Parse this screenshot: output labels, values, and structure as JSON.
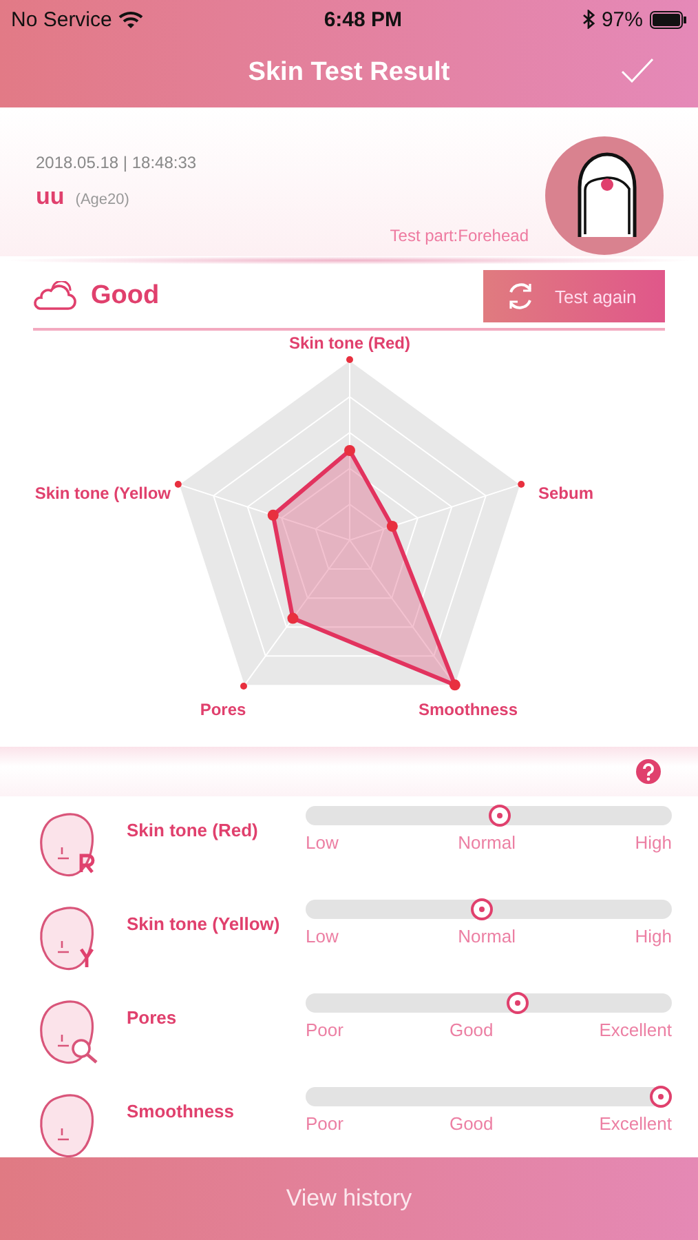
{
  "status_bar": {
    "carrier": "No Service",
    "time": "6:48 PM",
    "battery": "97%"
  },
  "nav": {
    "title": "Skin Test Result"
  },
  "record": {
    "datetime": "2018.05.18 | 18:48:33",
    "name": "uu",
    "age": "(Age20)",
    "test_part": "Test part:Forehead"
  },
  "result": {
    "rating": "Good",
    "button": "Test again"
  },
  "radar": {
    "axes": [
      {
        "label": "Skin tone (Red)"
      },
      {
        "label": "Sebum"
      },
      {
        "label": "Smoothness"
      },
      {
        "label": "Pores"
      },
      {
        "label": "Skin tone (Yellow"
      }
    ]
  },
  "metrics": [
    {
      "kind": "red",
      "label": "Skin tone (Red)",
      "level": 0.53,
      "scale": [
        "Low",
        "Normal",
        "High"
      ]
    },
    {
      "kind": "yellow",
      "label": "Skin tone (Yellow)",
      "level": 0.48,
      "scale": [
        "Low",
        "Normal",
        "High"
      ]
    },
    {
      "kind": "pores",
      "label": "Pores",
      "level": 0.58,
      "scale": [
        "Poor",
        "Good",
        "Excellent"
      ]
    },
    {
      "kind": "smooth",
      "label": "Smoothness",
      "level": 0.97,
      "scale": [
        "Poor",
        "Good",
        "Excellent"
      ]
    }
  ],
  "footer": {
    "button": "View history"
  }
}
